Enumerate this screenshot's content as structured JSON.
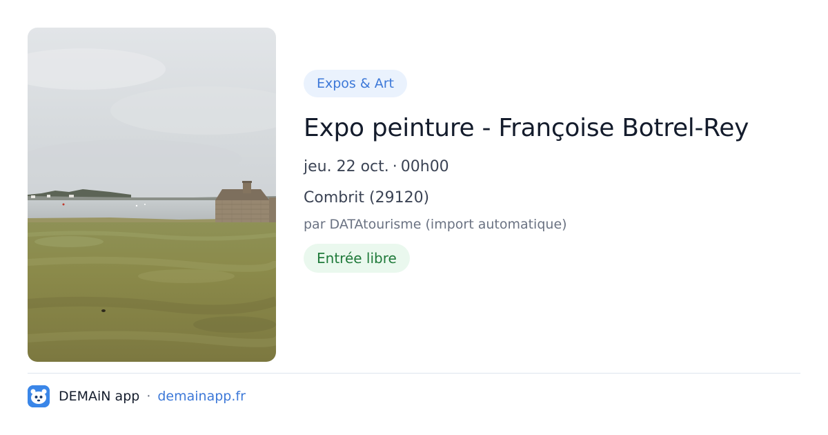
{
  "event": {
    "category": "Expos & Art",
    "title": "Expo peinture - Françoise Botrel-Rey",
    "date": "jeu. 22 oct.",
    "date_separator": "·",
    "time": "00h00",
    "location": "Combrit (29120)",
    "organizer": "par DATAtourisme (import automatique)",
    "price": "Entrée libre",
    "image": {
      "subject": "coastal landscape with stone cottage, grassy field and bay",
      "colors": {
        "sky": "#d9dcdf",
        "water": "#c4c9cc",
        "grass": "#8a8a4c",
        "stone": "#8d7d66"
      }
    }
  },
  "footer": {
    "app_icon": "demain-app-icon",
    "app_name": "DEMAiN app",
    "separator": "·",
    "url": "demainapp.fr"
  },
  "colors": {
    "accent": "#3c78d8",
    "category_bg": "#eaf2fd",
    "price_bg": "#eaf8ee",
    "price_text": "#1f7a3a",
    "title_text": "#141c2c",
    "body_text": "#3b4354",
    "muted_text": "#6a7282",
    "app_icon_bg": "#3a86e8"
  }
}
